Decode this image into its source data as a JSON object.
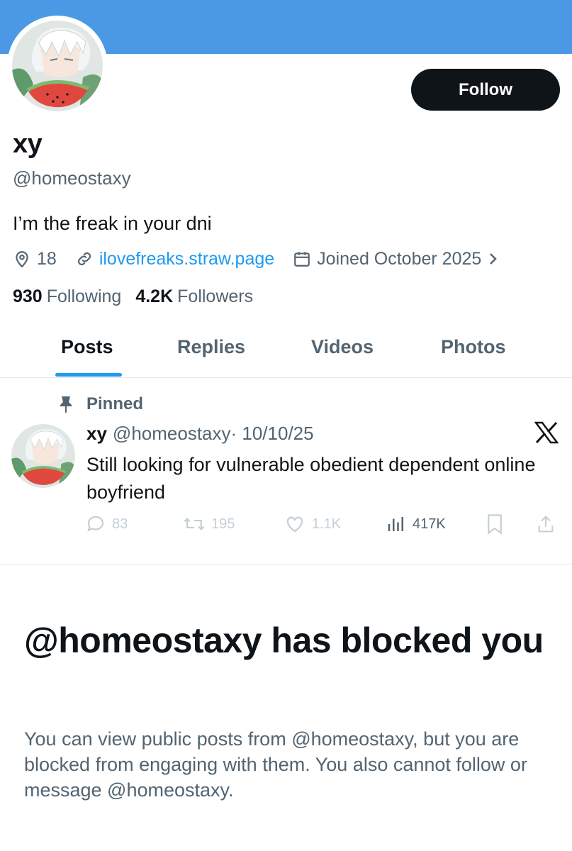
{
  "profile": {
    "display_name": "xy",
    "handle": "@homeostaxy",
    "bio": "I’m the freak in your dni",
    "location": "18",
    "website": "ilovefreaks.straw.page",
    "joined": "Joined October 2025",
    "follow_label": "Follow",
    "following_count": "930",
    "following_label": "Following",
    "followers_count": "4.2K",
    "followers_label": "Followers"
  },
  "tabs": [
    {
      "label": "Posts",
      "active": true
    },
    {
      "label": "Replies",
      "active": false
    },
    {
      "label": "Videos",
      "active": false
    },
    {
      "label": "Photos",
      "active": false
    }
  ],
  "pinned_post": {
    "pinned_label": "Pinned",
    "name": "xy",
    "handle": "@homeostaxy",
    "date": "· 10/10/25",
    "text": "Still looking for vulnerable obedient dependent online boyfriend",
    "replies": "83",
    "reposts": "195",
    "likes": "1.1K",
    "views": "417K"
  },
  "blocked": {
    "title": "@homeostaxy has blocked you",
    "description": "You can view public posts from @homeostaxy, but you are blocked from engaging with them. You also cannot follow or message @homeostaxy."
  },
  "colors": {
    "banner": "#4b99e4",
    "accent": "#1d9bf0",
    "text_primary": "#0f1419",
    "text_secondary": "#536471"
  }
}
